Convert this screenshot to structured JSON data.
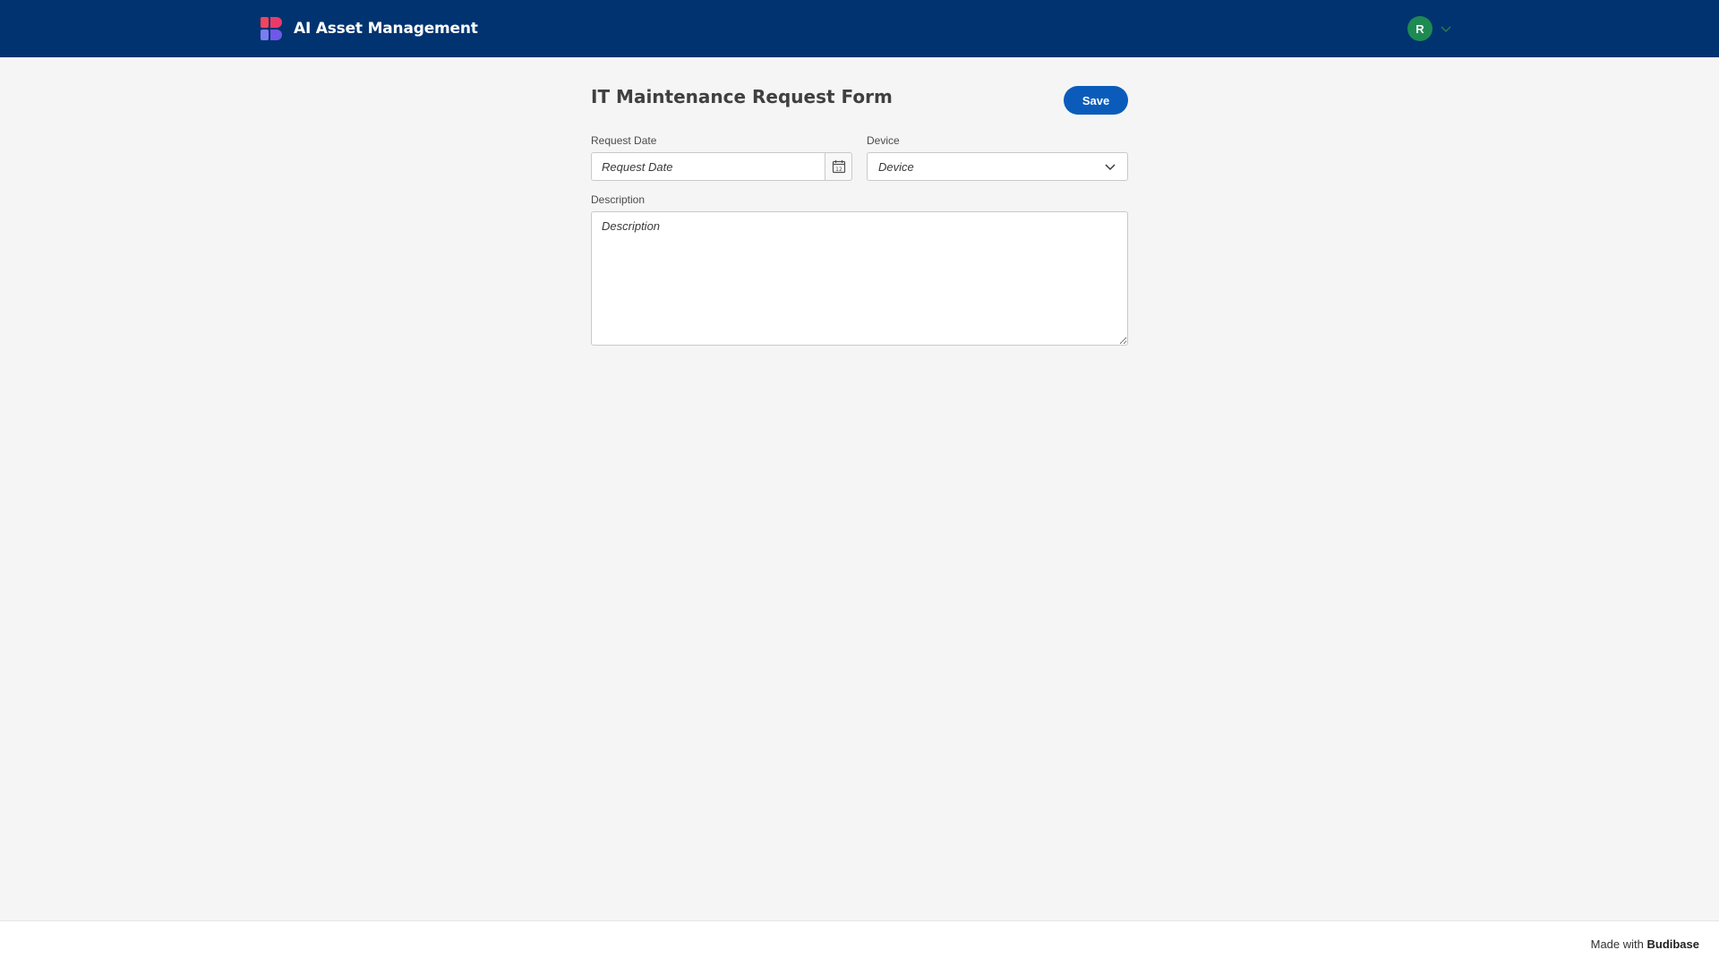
{
  "header": {
    "app_title": "AI Asset Management",
    "logo_icon": "budibase-logo-icon",
    "user": {
      "avatar_initial": "R",
      "avatar_color": "#1e8a53",
      "menu_icon": "chevron-down-icon"
    }
  },
  "form": {
    "title": "IT Maintenance Request Form",
    "save_label": "Save",
    "save_color": "#0b5cba",
    "request_date": {
      "label": "Request Date",
      "placeholder": "Request Date",
      "icon": "calendar-icon"
    },
    "device": {
      "label": "Device",
      "placeholder": "Device",
      "icon": "chevron-down-icon"
    },
    "description": {
      "label": "Description",
      "placeholder": "Description"
    }
  },
  "footer": {
    "made_with_prefix": "Made with",
    "made_with_brand": "Budibase"
  },
  "colors": {
    "header_bg": "#003370",
    "page_bg": "#f5f5f5"
  }
}
